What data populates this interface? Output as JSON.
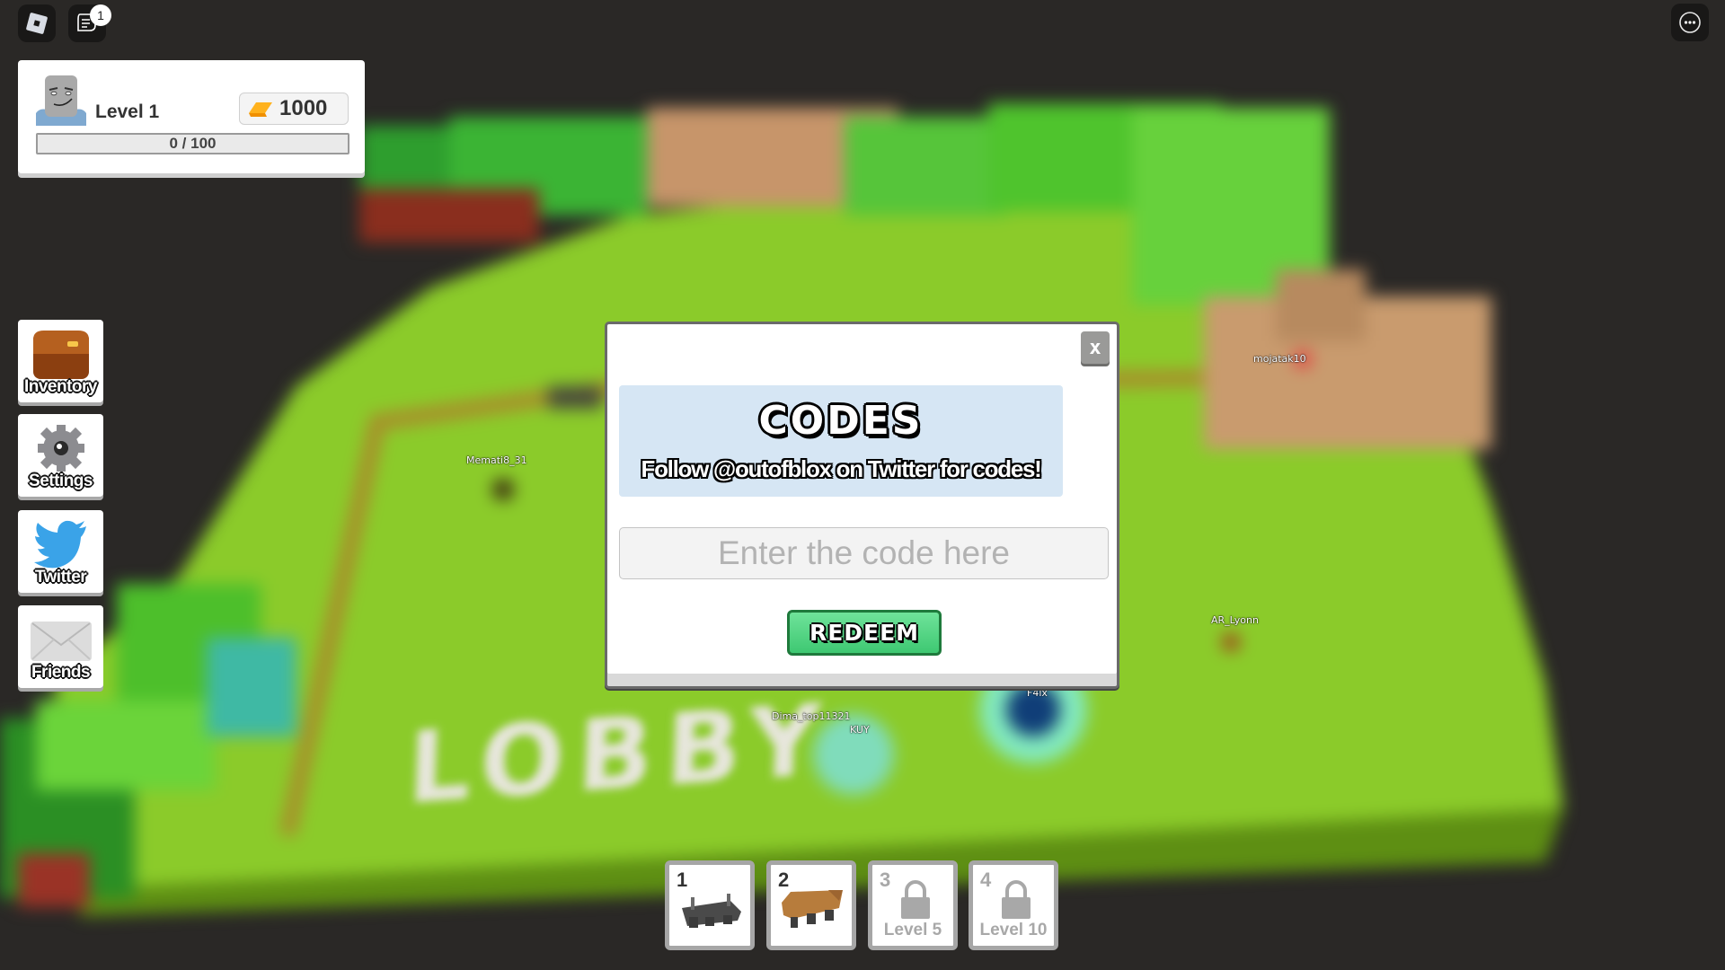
{
  "top_bar": {
    "roblox_menu_icon": "roblox-logo-icon",
    "chat_icon": "chat-icon",
    "chat_badge": "1",
    "more_icon": "more-options-icon"
  },
  "player": {
    "level_label": "Level 1",
    "gold": "1000",
    "xp_text": "0 / 100",
    "xp_progress": 0
  },
  "side_menu": [
    {
      "label": "Inventory",
      "icon": "chest-icon"
    },
    {
      "label": "Settings",
      "icon": "gear-icon"
    },
    {
      "label": "Twitter",
      "icon": "twitter-bird-icon"
    },
    {
      "label": "Friends",
      "icon": "envelope-icon"
    }
  ],
  "codes_dialog": {
    "close_label": "x",
    "title": "CODES",
    "subtitle": "Follow @outofblox on Twitter for codes!",
    "input_value": "",
    "input_placeholder": "Enter the code here",
    "redeem_label": "REDEEM"
  },
  "world": {
    "lobby_sign": "LOBBY",
    "player_names": [
      "Memati8_31",
      "mojatak10",
      "AR_Lyonn",
      "Dima_top11321",
      "KUY",
      "F4ix"
    ]
  },
  "hotbar": [
    {
      "number": "1",
      "locked": false,
      "item": "gray-tower-base"
    },
    {
      "number": "2",
      "locked": false,
      "item": "brown-tower-base"
    },
    {
      "number": "3",
      "locked": true,
      "requirement": "Level 5"
    },
    {
      "number": "4",
      "locked": true,
      "requirement": "Level 10"
    }
  ],
  "colors": {
    "redeem_green": "#3ec872",
    "header_blue": "#d6e6f4",
    "grass": "#86c926",
    "background": "#2a2826"
  }
}
